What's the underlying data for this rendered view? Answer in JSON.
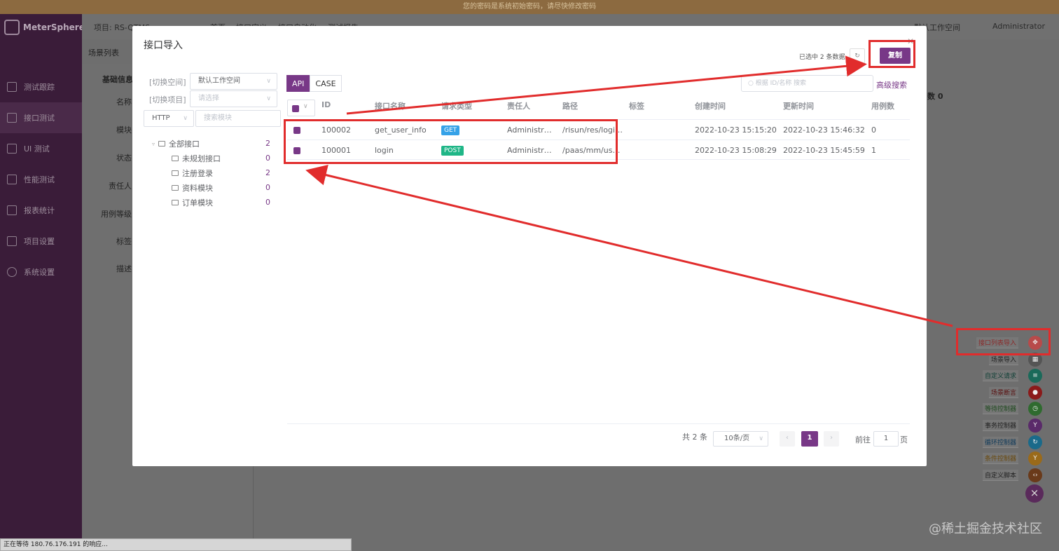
{
  "banner": "您的密码是系统初始密码，请尽快修改密码",
  "app": {
    "name": "MeterSphere"
  },
  "sidebar": {
    "items": [
      {
        "label": "测试跟踪",
        "icon": "clipboard-icon"
      },
      {
        "label": "接口测试",
        "icon": "api-icon"
      },
      {
        "label": "UI 测试",
        "icon": "ui-icon"
      },
      {
        "label": "性能测试",
        "icon": "chart-icon"
      },
      {
        "label": "报表统计",
        "icon": "report-icon"
      },
      {
        "label": "项目设置",
        "icon": "folder-icon"
      },
      {
        "label": "系统设置",
        "icon": "gear-icon"
      }
    ]
  },
  "topbar": {
    "project": "项目: RS-QTMS",
    "tabs": [
      "首页",
      "接口定义",
      "接口自动化",
      "测试报告"
    ],
    "workspace": "默认工作空间",
    "user": "Administrator"
  },
  "background": {
    "tab": "场景列表",
    "section": "基础信息",
    "fields": [
      "名称",
      "模块",
      "状态",
      "责任人",
      "用例等级",
      "标签",
      "描述"
    ],
    "count_label": "数 0"
  },
  "dialog": {
    "title": "接口导入",
    "selected_info": "已选中 2 条数据",
    "copy_label": "复制",
    "workspace_label": "[切换空间]",
    "workspace_value": "默认工作空间",
    "project_label": "[切换项目]",
    "project_placeholder": "请选择",
    "protocol": "HTTP",
    "module_search_placeholder": "搜索模块",
    "tree": [
      {
        "label": "全部接口",
        "count": "2"
      },
      {
        "label": "未规划接口",
        "count": "0"
      },
      {
        "label": "注册登录",
        "count": "2"
      },
      {
        "label": "资料模块",
        "count": "0"
      },
      {
        "label": "订单模块",
        "count": "0"
      }
    ],
    "mode_api": "API",
    "mode_case": "CASE",
    "search_placeholder": "根据 ID/名称 搜索",
    "advanced_search": "高级搜索",
    "columns": [
      "ID",
      "接口名称",
      "请求类型",
      "责任人",
      "路径",
      "标签",
      "创建时间",
      "更新时间",
      "用例数"
    ],
    "rows": [
      {
        "id": "100002",
        "name": "get_user_info",
        "method": "GET",
        "owner": "Administr…",
        "path": "/risun/res/logi…",
        "tag": "",
        "created": "2022-10-23 15:15:20",
        "updated": "2022-10-23 15:46:32",
        "cases": "0"
      },
      {
        "id": "100001",
        "name": "login",
        "method": "POST",
        "owner": "Administr…",
        "path": "/paas/mm/us…",
        "tag": "",
        "created": "2022-10-23 15:08:29",
        "updated": "2022-10-23 15:45:59",
        "cases": "1"
      }
    ],
    "pagination": {
      "total": "共 2 条",
      "page_size": "10条/页",
      "current": "1",
      "goto_label": "前往",
      "goto_value": "1",
      "page_suffix": "页"
    }
  },
  "fab_menu": [
    {
      "label": "接口列表导入",
      "color": "#c0504d"
    },
    {
      "label": "场景导入",
      "color": "#555555"
    },
    {
      "label": "自定义请求",
      "color": "#1a6a5a"
    },
    {
      "label": "场景断言",
      "color": "#8b1a1a"
    },
    {
      "label": "等待控制器",
      "color": "#2f6b2f"
    },
    {
      "label": "事务控制器",
      "color": "#5a2a6a"
    },
    {
      "label": "循环控制器",
      "color": "#1a6a8a"
    },
    {
      "label": "条件控制器",
      "color": "#9a6a1a"
    },
    {
      "label": "自定义脚本",
      "color": "#6a3a1a"
    }
  ],
  "status_bar": "正在等待 180.76.176.191 的响应...",
  "watermark": "@稀土掘金技术社区"
}
